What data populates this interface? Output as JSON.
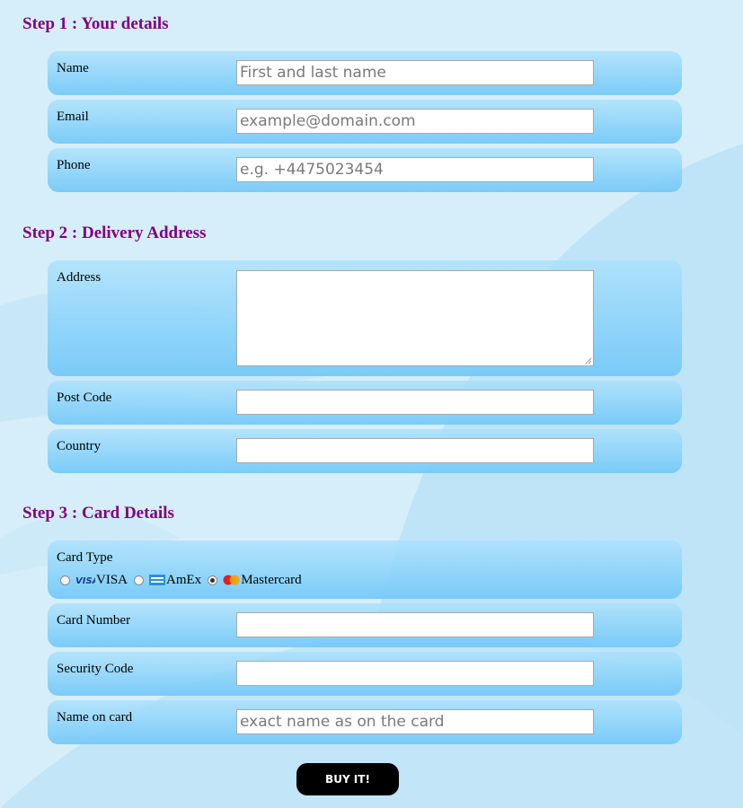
{
  "step1": {
    "title": "Step 1 : Your details",
    "name_label": "Name",
    "name_placeholder": "First and last name",
    "email_label": "Email",
    "email_placeholder": "example@domain.com",
    "phone_label": "Phone",
    "phone_placeholder": "e.g. +4475023454"
  },
  "step2": {
    "title": "Step 2 : Delivery Address",
    "address_label": "Address",
    "postcode_label": "Post Code",
    "country_label": "Country"
  },
  "step3": {
    "title": "Step 3 : Card Details",
    "card_type_label": "Card Type",
    "card_types": [
      {
        "label": "VISA",
        "icon": "visa-icon",
        "checked": false
      },
      {
        "label": "AmEx",
        "icon": "amex-icon",
        "checked": false
      },
      {
        "label": "Mastercard",
        "icon": "mastercard-icon",
        "checked": true
      }
    ],
    "card_number_label": "Card Number",
    "security_code_label": "Security Code",
    "name_on_card_label": "Name on card",
    "name_on_card_placeholder": "exact name as on the card"
  },
  "buy_button": {
    "label": "BUY IT!"
  },
  "colors": {
    "step_title": "#800080",
    "row_background": "#7fcdf8",
    "page_background": "#cfeaf8",
    "button_background": "#000000"
  }
}
